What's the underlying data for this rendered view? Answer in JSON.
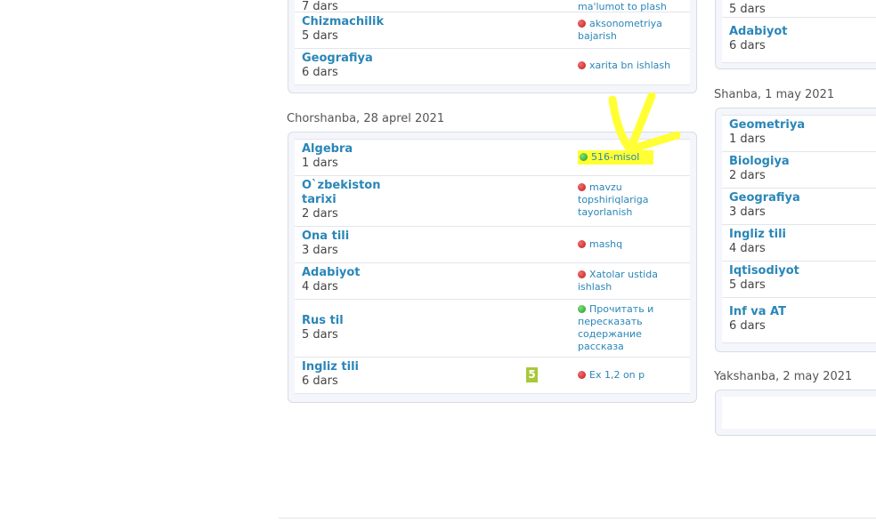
{
  "left_top": {
    "partial_top_hw": "ma'lumot to plash",
    "rows": [
      {
        "subject": "Chizmachilik",
        "lesson": "5 dars",
        "status": "red",
        "homework": "aksonometriya bajarish"
      },
      {
        "subject": "Geografiya",
        "lesson": "6 dars",
        "status": "red",
        "homework": "xarita bn ishlash"
      }
    ]
  },
  "wednesday": {
    "title": "Chorshanba, 28 aprel 2021",
    "rows": [
      {
        "subject": "Algebra",
        "lesson": "1 dars",
        "status": "green",
        "homework": "516-misol",
        "mark": ""
      },
      {
        "subject": "O`zbekiston tarixi",
        "lesson": "2 dars",
        "status": "red",
        "homework": "mavzu topshiriqlariga tayorlanish",
        "mark": ""
      },
      {
        "subject": "Ona tili",
        "lesson": "3 dars",
        "status": "red",
        "homework": "mashq",
        "mark": ""
      },
      {
        "subject": "Adabiyot",
        "lesson": "4 dars",
        "status": "red",
        "homework": "Xatolar ustida ishlash",
        "mark": ""
      },
      {
        "subject": "Rus til",
        "lesson": "5 dars",
        "status": "green",
        "homework": "Прочитать и пересказать содержание рассказа",
        "mark": ""
      },
      {
        "subject": "Ingliz tili",
        "lesson": "6 dars",
        "status": "red",
        "homework": "Ex 1,2 on p",
        "mark": "5"
      }
    ]
  },
  "right_top": {
    "partial_top_lesson": "5 dars",
    "rows": [
      {
        "subject": "Adabiyot",
        "lesson": "6 dars"
      }
    ]
  },
  "saturday": {
    "title": "Shanba, 1 may 2021",
    "rows": [
      {
        "subject": "Geometriya",
        "lesson": "1 dars"
      },
      {
        "subject": "Biologiya",
        "lesson": "2 dars"
      },
      {
        "subject": "Geografiya",
        "lesson": "3 dars"
      },
      {
        "subject": "Ingliz tili",
        "lesson": "4 dars"
      },
      {
        "subject": "Iqtisodiyot",
        "lesson": "5 dars"
      },
      {
        "subject": "Inf va AT",
        "lesson": "6 dars"
      }
    ]
  },
  "sunday": {
    "title": "Yakshanba, 2 may 2021"
  },
  "colors": {
    "link": "#2a86b8",
    "highlight": "#ffff33",
    "mark_badge": "#a8c838",
    "status_red": "#c11a1a",
    "status_green": "#1e9a1e"
  }
}
